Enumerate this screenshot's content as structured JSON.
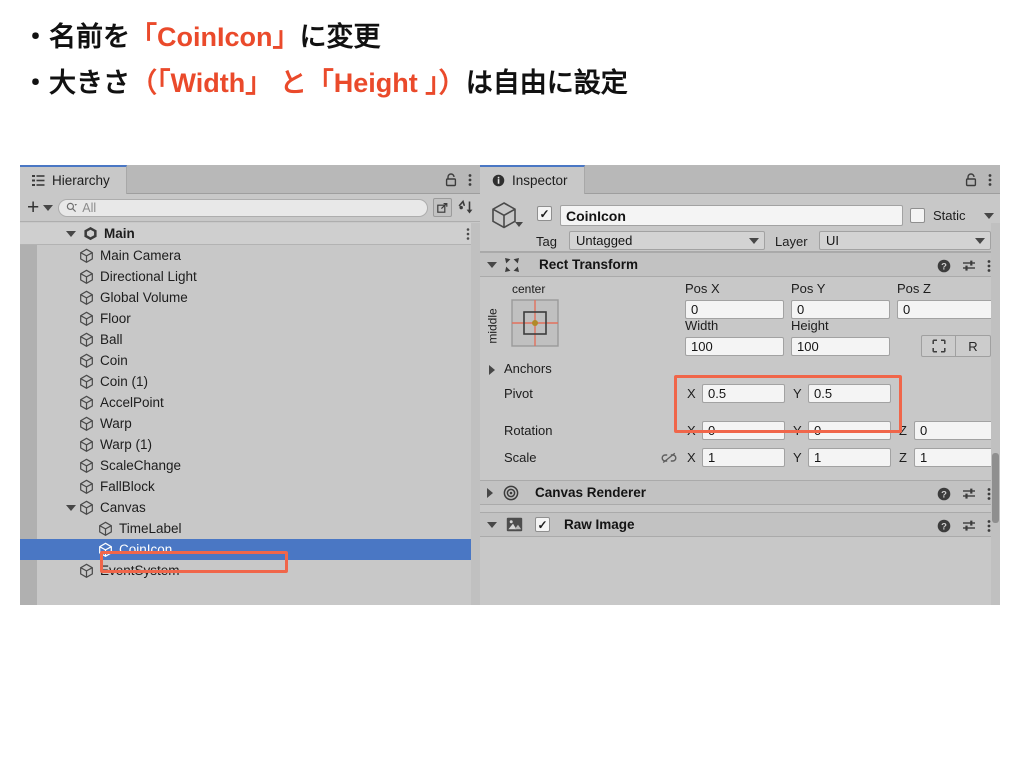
{
  "caption": {
    "line1_pre": "・名前を",
    "line1_hl": "「CoinIcon」",
    "line1_post": "に変更",
    "line2_pre": "・大きさ",
    "line2_hl": "（「Width」 と「Height 」）",
    "line2_post": "は自由に設定"
  },
  "hierarchy": {
    "tab_label": "Hierarchy",
    "tab_icon": "hierarchy-list-icon",
    "lock_icon": "lock-icon",
    "kebab_icon": "kebab-menu-icon",
    "add_button": "+",
    "add_dropdown_icon": "chevron-down-icon",
    "search_icon": "search-icon",
    "search_placeholder": "All",
    "search_value": "",
    "save_search_icon": "save-search-icon",
    "sort_icon": "alphabetical-sort-icon",
    "scene_name": "Main",
    "scene_icon": "unity-scene-icon",
    "items": [
      {
        "label": "Main Camera",
        "depth": 1,
        "expandable": false,
        "expanded": false,
        "selected": false
      },
      {
        "label": "Directional Light",
        "depth": 1,
        "expandable": false,
        "expanded": false,
        "selected": false
      },
      {
        "label": "Global Volume",
        "depth": 1,
        "expandable": false,
        "expanded": false,
        "selected": false
      },
      {
        "label": "Floor",
        "depth": 1,
        "expandable": false,
        "expanded": false,
        "selected": false
      },
      {
        "label": "Ball",
        "depth": 1,
        "expandable": false,
        "expanded": false,
        "selected": false
      },
      {
        "label": "Coin",
        "depth": 1,
        "expandable": false,
        "expanded": false,
        "selected": false
      },
      {
        "label": "Coin (1)",
        "depth": 1,
        "expandable": false,
        "expanded": false,
        "selected": false
      },
      {
        "label": "AccelPoint",
        "depth": 1,
        "expandable": false,
        "expanded": false,
        "selected": false
      },
      {
        "label": "Warp",
        "depth": 1,
        "expandable": false,
        "expanded": false,
        "selected": false
      },
      {
        "label": "Warp (1)",
        "depth": 1,
        "expandable": false,
        "expanded": false,
        "selected": false
      },
      {
        "label": "ScaleChange",
        "depth": 1,
        "expandable": false,
        "expanded": false,
        "selected": false
      },
      {
        "label": "FallBlock",
        "depth": 1,
        "expandable": false,
        "expanded": false,
        "selected": false
      },
      {
        "label": "Canvas",
        "depth": 1,
        "expandable": true,
        "expanded": true,
        "selected": false
      },
      {
        "label": "TimeLabel",
        "depth": 2,
        "expandable": false,
        "expanded": false,
        "selected": false
      },
      {
        "label": "CoinIcon",
        "depth": 2,
        "expandable": false,
        "expanded": false,
        "selected": true
      },
      {
        "label": "EventSystem",
        "depth": 1,
        "expandable": false,
        "expanded": false,
        "selected": false
      }
    ]
  },
  "inspector": {
    "tab_label": "Inspector",
    "tab_icon": "info-circle-icon",
    "lock_icon": "lock-icon",
    "kebab_icon": "kebab-menu-icon",
    "gameobject_icon": "gameobject-cube-icon",
    "enabled_checked": true,
    "name_value": "CoinIcon",
    "static_label": "Static",
    "static_checked": false,
    "static_dropdown_icon": "chevron-down-icon",
    "tag_label": "Tag",
    "tag_value": "Untagged",
    "layer_label": "Layer",
    "layer_value": "UI",
    "rect_transform": {
      "title": "Rect Transform",
      "icon": "rect-transform-icon",
      "expanded": true,
      "help_icon": "help-circle-icon",
      "preset_icon": "preset-sliders-icon",
      "kebab_icon": "kebab-menu-icon",
      "anchor_preset_top_label": "center",
      "anchor_preset_side_label": "middle",
      "pos_x_label": "Pos X",
      "pos_x_value": "0",
      "pos_y_label": "Pos Y",
      "pos_y_value": "0",
      "pos_z_label": "Pos Z",
      "pos_z_value": "0",
      "width_label": "Width",
      "width_value": "100",
      "height_label": "Height",
      "height_value": "100",
      "blueprint_icon": "blueprint-mode-icon",
      "raw_button": "R",
      "anchors_label": "Anchors",
      "pivot_label": "Pivot",
      "pivot_x_axis": "X",
      "pivot_x_value": "0.5",
      "pivot_y_axis": "Y",
      "pivot_y_value": "0.5",
      "rotation_label": "Rotation",
      "rotation_x_axis": "X",
      "rotation_x_value": "0",
      "rotation_y_axis": "Y",
      "rotation_y_value": "0",
      "rotation_z_axis": "Z",
      "rotation_z_value": "0",
      "scale_label": "Scale",
      "scale_link_icon": "broken-link-icon",
      "scale_x_axis": "X",
      "scale_x_value": "1",
      "scale_y_axis": "Y",
      "scale_y_value": "1",
      "scale_z_axis": "Z",
      "scale_z_value": "1"
    },
    "canvas_renderer": {
      "title": "Canvas Renderer",
      "icon": "canvas-renderer-icon",
      "expanded": false,
      "help_icon": "help-circle-icon",
      "preset_icon": "preset-sliders-icon",
      "kebab_icon": "kebab-menu-icon"
    },
    "raw_image": {
      "title": "Raw Image",
      "icon": "raw-image-picture-icon",
      "expanded": true,
      "enabled_checked": true,
      "help_icon": "help-circle-icon",
      "preset_icon": "preset-sliders-icon",
      "kebab_icon": "kebab-menu-icon"
    }
  },
  "colors": {
    "accent_red": "#f0664a",
    "highlight_text": "#ea4a2b",
    "selection_blue": "#4a77c4",
    "panel_bg": "#c8c8c8"
  }
}
